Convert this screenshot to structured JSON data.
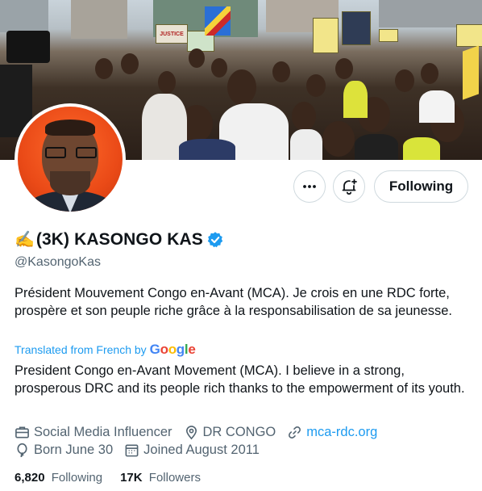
{
  "profile": {
    "name_emoji": "✍️",
    "name": "(3K) KASONGO KAS",
    "verified": true,
    "handle": "@KasongoKas",
    "bio_original": "Président Mouvement Congo en-Avant (MCA). Je crois en une RDC forte, prospère et son peuple riche grâce à la responsabilisation de sa jeunesse.",
    "translated_label": "Translated from French by",
    "translator": "Google",
    "bio_translated": "President Congo en-Avant Movement (MCA). I believe in a strong, prosperous DRC and its people rich thanks to the empowerment of its youth."
  },
  "meta": {
    "category": "Social Media Influencer",
    "location": "DR CONGO",
    "website": "mca-rdc.org",
    "birthday": "Born June 30",
    "joined": "Joined August 2011"
  },
  "stats": {
    "following_count": "6,820",
    "following_label": "Following",
    "followers_count": "17K",
    "followers_label": "Followers"
  },
  "actions": {
    "follow_button_label": "Following",
    "more_icon": "more-horizontal-icon",
    "notify_icon": "bell-plus-icon"
  },
  "banner": {
    "sign_texts": [
      "JUSTICE"
    ]
  },
  "colors": {
    "accent": "#1d9bf0",
    "text_primary": "#0f1419",
    "text_secondary": "#536471",
    "border": "#cfd9de",
    "avatar_background": "#ea4a17"
  }
}
